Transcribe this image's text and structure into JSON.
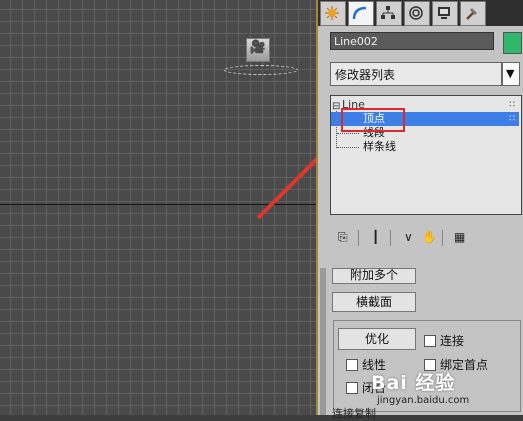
{
  "viewport": {
    "icons": [
      "camera-object-icon"
    ]
  },
  "panel": {
    "tabs": [
      {
        "name": "create-tab",
        "icon": "sun-icon"
      },
      {
        "name": "modify-tab",
        "icon": "modify-arc-icon"
      },
      {
        "name": "hierarchy-tab",
        "icon": "hierarchy-icon"
      },
      {
        "name": "motion-tab",
        "icon": "motion-icon"
      },
      {
        "name": "display-tab",
        "icon": "display-monitor-icon"
      },
      {
        "name": "utilities-tab",
        "icon": "hammer-icon"
      }
    ],
    "object_name": "Line002",
    "object_color": "#2fb86a",
    "modifier_list": "修改器列表",
    "stack": {
      "root": "Line",
      "items": [
        "顶点",
        "线段",
        "样条线"
      ],
      "selected": "顶点",
      "selected_color": "#3d7fe6"
    },
    "rollout": {
      "attach_multi": "附加多个",
      "cross_section": "横截面",
      "refine": "优化",
      "connect": "连接",
      "linear": "线性",
      "bind_first": "绑定首点",
      "closed": "闭合",
      "bottom_label": "连接复制"
    },
    "watermark": {
      "text": "Bai 经验",
      "url": "jingyan.baidu.com"
    },
    "highlight_color": "#e0282a"
  }
}
